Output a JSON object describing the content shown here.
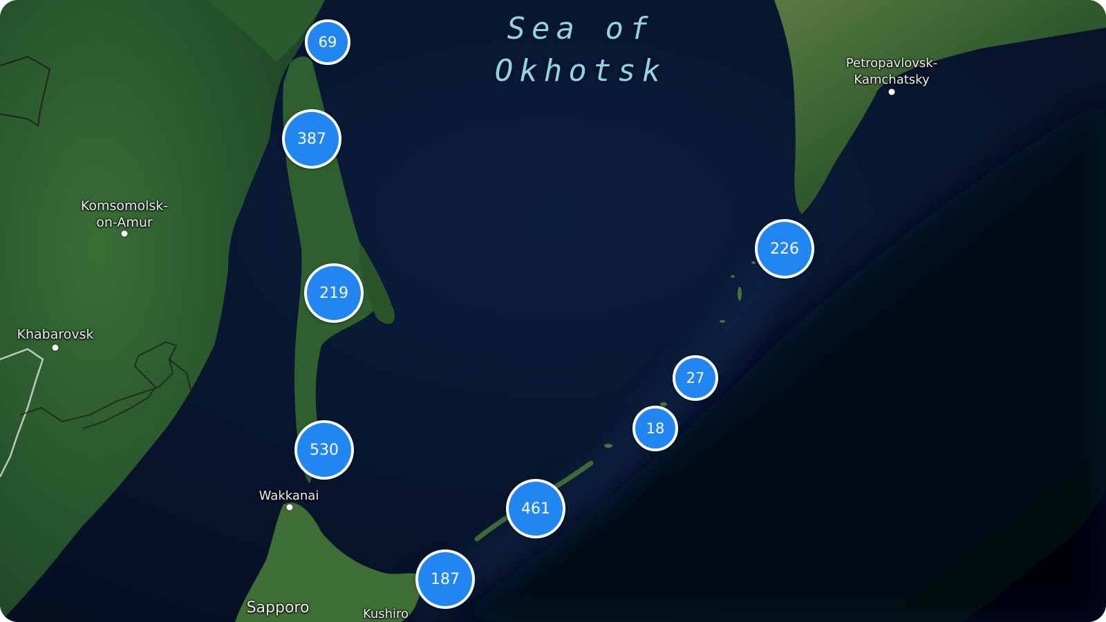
{
  "map": {
    "sea_label_line1": "Sea of",
    "sea_label_line2": "Okhotsk",
    "colors": {
      "ocean": "#071428",
      "land": "#23502a",
      "cluster_fill": "#2186f2",
      "cluster_border": "#ffffff",
      "sea_label": "#8ed4e4"
    }
  },
  "places": {
    "komsomolsk_line1": "Komsomolsk-",
    "komsomolsk_line2": "on-Amur",
    "khabarovsk": "Khabarovsk",
    "petropavlovsk_line1": "Petropavlovsk-",
    "petropavlovsk_line2": "Kamchatsky",
    "wakkanai": "Wakkanai",
    "sapporo": "Sapporo",
    "kushiro": "Kushiro"
  },
  "clusters": [
    {
      "count": "69"
    },
    {
      "count": "387"
    },
    {
      "count": "219"
    },
    {
      "count": "530"
    },
    {
      "count": "461"
    },
    {
      "count": "187"
    },
    {
      "count": "226"
    },
    {
      "count": "27"
    },
    {
      "count": "18"
    }
  ]
}
